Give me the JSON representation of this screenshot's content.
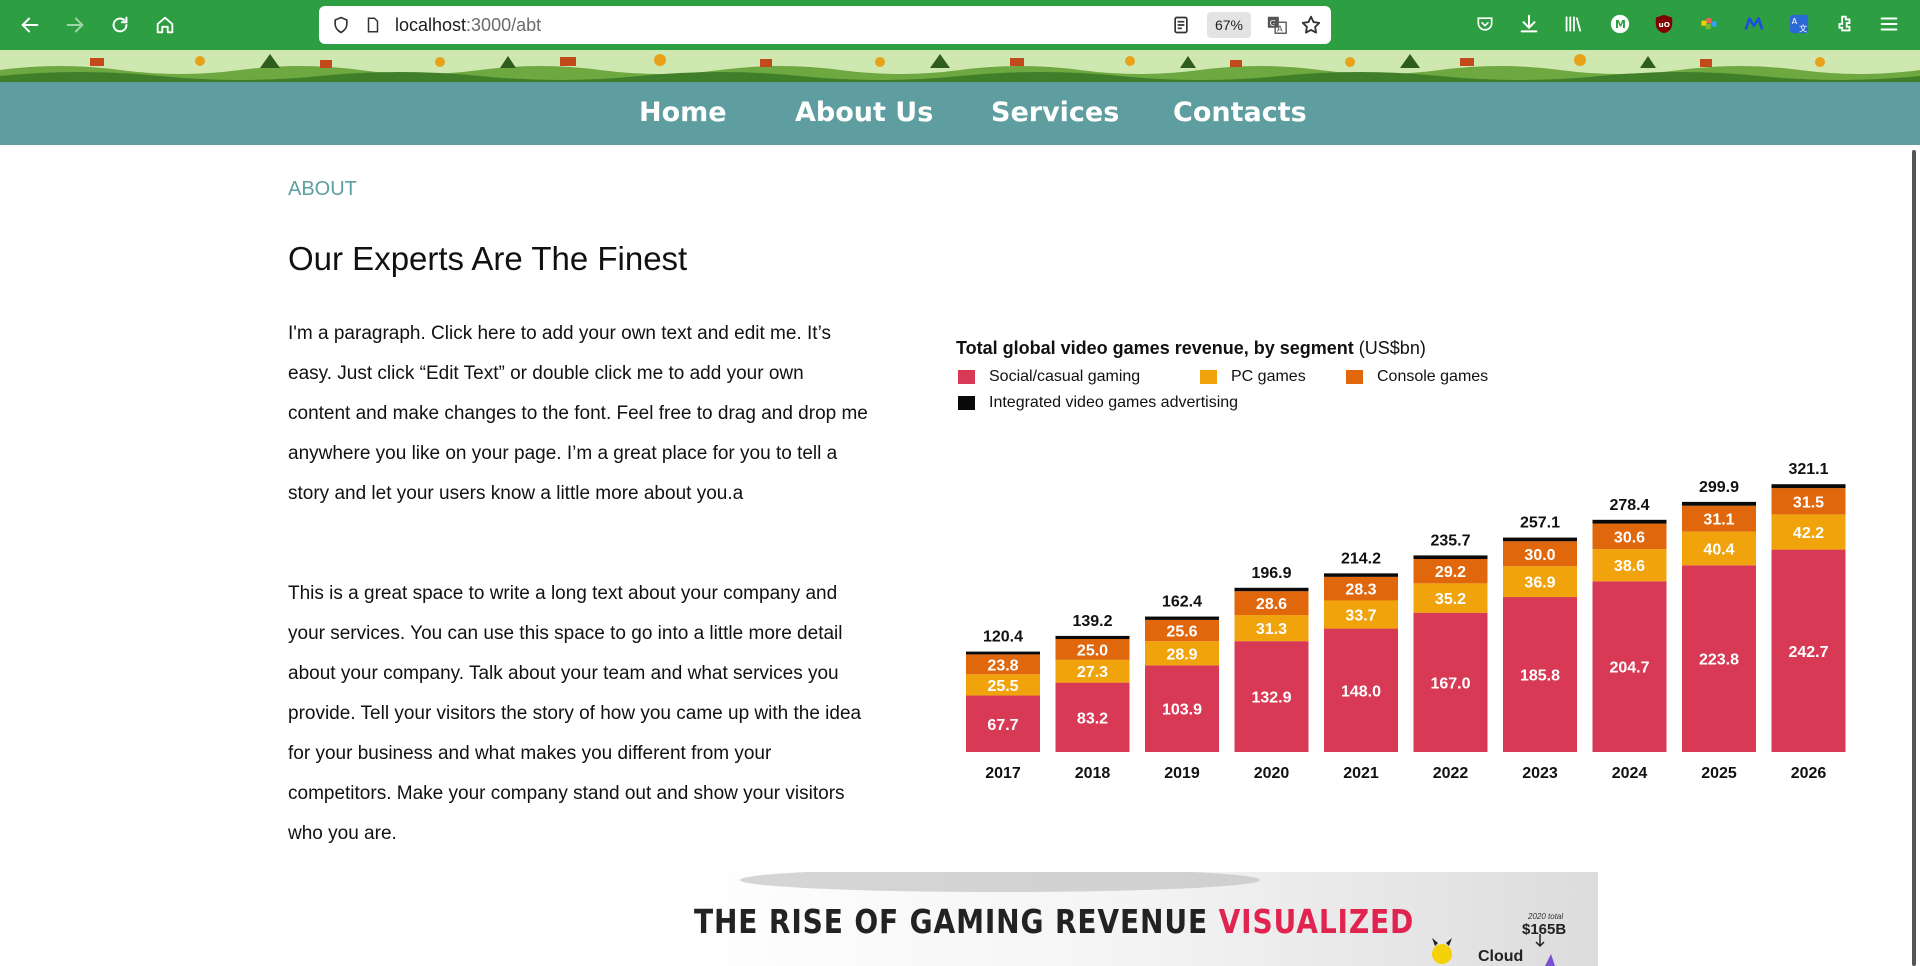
{
  "browser": {
    "url_host": "localhost",
    "url_path": ":3000/abt",
    "zoom": "67%"
  },
  "nav": {
    "items": [
      "Home",
      "About Us",
      "Services",
      "Contacts"
    ]
  },
  "about": {
    "label": "ABOUT",
    "heading": "Our Experts Are The Finest",
    "paragraph1": "I'm a paragraph. Click here to add your own text and edit me. It’s easy. Just click “Edit Text” or double click me to add your own content and make changes to the font. Feel free to drag and drop me anywhere you like on your page. I’m a great place for you to tell a story and let your users know a little more about you.a",
    "paragraph2": "This is a great space to write a long text about your company and your services. You can use this space to go into a little more detail about your company. Talk about your team and what services you provide. Tell your visitors the story of how you came up with the idea for your business and what makes you different from your competitors. Make your company stand out and show your visitors who you are."
  },
  "chart_data": {
    "type": "bar",
    "stacked": true,
    "title": "Total global video games revenue, by segment",
    "title_unit": "(US$bn)",
    "categories": [
      "2017",
      "2018",
      "2019",
      "2020",
      "2021",
      "2022",
      "2023",
      "2024",
      "2025",
      "2026"
    ],
    "totals": [
      "120.4",
      "139.2",
      "162.4",
      "196.9",
      "214.2",
      "235.7",
      "257.1",
      "278.4",
      "299.9",
      "321.1"
    ],
    "series": [
      {
        "name": "Social/casual gaming",
        "color": "#d83a56",
        "values": [
          67.7,
          83.2,
          103.9,
          132.9,
          148.0,
          167.0,
          185.8,
          204.7,
          223.8,
          242.7
        ],
        "labels": [
          "67.7",
          "83.2",
          "103.9",
          "132.9",
          "148.0",
          "167.0",
          "185.8",
          "204.7",
          "223.8",
          "242.7"
        ]
      },
      {
        "name": "PC games",
        "color": "#f0a30a",
        "values": [
          25.5,
          27.3,
          28.9,
          31.3,
          33.7,
          35.2,
          36.9,
          38.6,
          40.4,
          42.2
        ],
        "labels": [
          "25.5",
          "27.3",
          "28.9",
          "31.3",
          "33.7",
          "35.2",
          "36.9",
          "38.6",
          "40.4",
          "42.2"
        ]
      },
      {
        "name": "Console games",
        "color": "#e0670c",
        "values": [
          23.8,
          25.0,
          25.6,
          28.6,
          28.3,
          29.2,
          30.0,
          30.6,
          31.1,
          31.5
        ],
        "labels": [
          "23.8",
          "25.0",
          "25.6",
          "28.6",
          "28.3",
          "29.2",
          "30.0",
          "30.6",
          "31.1",
          "31.5"
        ]
      },
      {
        "name": "Integrated video games advertising",
        "color": "#0a0a0a",
        "values": [
          3.4,
          3.7,
          4.0,
          4.1,
          4.2,
          4.3,
          4.4,
          4.5,
          4.6,
          4.7
        ],
        "labels": []
      }
    ]
  },
  "infographic": {
    "title": "THE RISE OF GAMING REVENUE",
    "title_accent": "VISUALIZED",
    "total_label": "2020 total",
    "total_value": "$165B",
    "segment": "Cloud"
  },
  "colors": {
    "toolbar": "#2e9e43",
    "nav": "#5f9ea0",
    "accent": "#5f9ea0"
  },
  "icons": [
    "back-icon",
    "forward-icon",
    "reload-icon",
    "home-icon",
    "shield-icon",
    "page-icon",
    "reader-icon",
    "translate-icon",
    "star-icon",
    "pocket-icon",
    "download-icon",
    "library-icon",
    "extension-icon",
    "menu-icon"
  ]
}
